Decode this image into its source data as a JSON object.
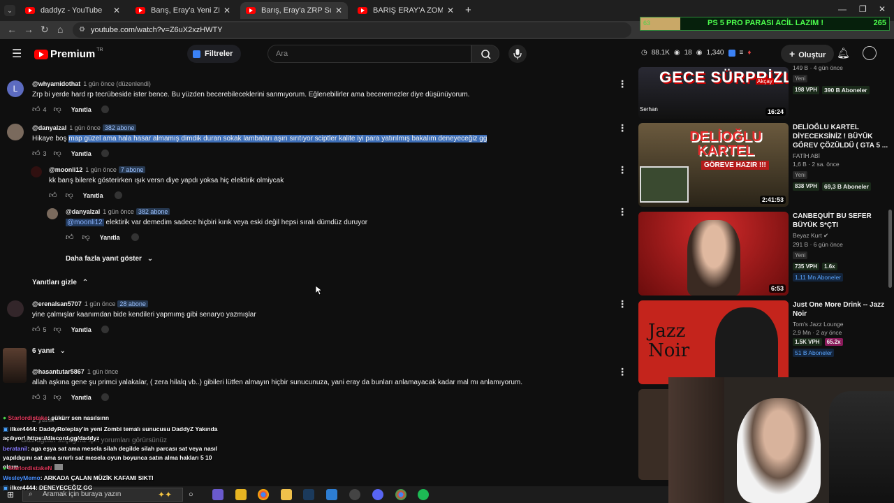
{
  "tabs": [
    {
      "title": "daddyz - YouTube"
    },
    {
      "title": "Barış, Eray'a Yeni ZRP Sunucusu"
    },
    {
      "title": "Barış, Eray'a ZRP Sunucusunun"
    },
    {
      "title": "BARIŞ ERAY'A ZOMBİ RP SUNU"
    }
  ],
  "address": {
    "url": "youtube.com/watch?v=Z6uX2xzHWTY"
  },
  "header": {
    "logo": "Premium",
    "region": "TR",
    "filter_label": "Filtreler",
    "search_placeholder": "Ara",
    "stats": [
      "88.1K",
      "18",
      "1,340"
    ],
    "create_label": "Oluştur"
  },
  "banner": {
    "left": "63",
    "message": "PS 5 PRO PARASI ACİL LAZIM !",
    "count": "265",
    "progress_fraction": 0.16
  },
  "comments": [
    {
      "handle": "@whyamidothat",
      "time": "1 gün önce (düzenlendi)",
      "text": "Zrp bi yerde hard rp tecrübeside ister bence. Bu yüzden becerebileceklerini sanmıyorum. Eğlenebilirler ama beceremezler diye düşünüyorum.",
      "likes": "4",
      "reply_label": "Yanıtla"
    },
    {
      "handle": "@danyalzal",
      "time": "1 gün önce",
      "badge": "382 abone",
      "text_plain": "Hikaye boş ",
      "text_highlight": "map güzel ama hala hasar almamış dimdik duran sokak lambaları aşırı sırıtıyor sciptler kalite iyi para yatırılmış bakalım deneyeceğiz gg",
      "likes": "3",
      "reply_label": "Yanıtla"
    },
    {
      "handle": "@moonli12",
      "time": "1 gün önce",
      "badge": "7 abone",
      "text": "kk barış  bilerek gösterirken ışık versn diye yapdı yoksa hiç elektirik olmiycak",
      "likes": "",
      "reply_label": "Yanıtla"
    },
    {
      "handle": "@danyalzal",
      "time": "1 gün önce",
      "badge": "382 abone",
      "mention": "@moonli12",
      "text": " elektirik var demedim sadece hiçbiri kırık veya eski değil hepsi sıralı dümdüz duruyor",
      "likes": "",
      "reply_label": "Yanıtla"
    },
    {
      "handle": "@erenalsan5707",
      "time": "1 gün önce",
      "badge": "28 abone",
      "text": "yine çalmışlar kaanımdan bide kendileri yapmımş gibi senaryo yazmışlar",
      "likes": "5",
      "reply_label": "Yanıtla"
    },
    {
      "handle": "@hasantutar5867",
      "time": "1 gün önce",
      "text": "allah aşkına gene şu primci yalakalar, ( zera hilalq vb..) gibileri lütfen almayın hiçbir sunucunuza, yani eray da bunları anlamayacak kadar mal mı anlamıyorum.",
      "likes": "3",
      "reply_label": "Yanıtla"
    }
  ],
  "links": {
    "more_replies": "Daha fazla yanıt göster",
    "hide_replies": "Yanıtları gizle",
    "six_replies": "6 yanıt"
  },
  "videos": [
    {
      "title": "",
      "channel": "",
      "meta": "149 B · 4 gün önce",
      "new": "Yeni",
      "vph": "198 VPH",
      "subs": "390 B Aboneler",
      "duration": "16:24",
      "thumb_text": "GECE SÜRPRİZLERİ",
      "thumb_sub": "Serhan",
      "thumb_tag": "Akçay"
    },
    {
      "title": "DELİOĞLU KARTEL DİYECEKSİNİZ ! BÜYÜK GÖREV ÇÖZÜLDÜ ( GTA 5 ...",
      "channel": "FATİH ABİ",
      "meta": "1,6 B · 2 sa. önce",
      "new": "Yeni",
      "vph": "838 VPH",
      "subs": "69,3 B Aboneler",
      "duration": "2:41:53",
      "thumb_text": "DELİOĞLU KARTEL",
      "thumb_sub": "GÖREVE HAZIR !!!"
    },
    {
      "title": "CANBEQUİT BU SEFER BÜYÜK S*ÇTI",
      "channel": "Beyaz Kurt",
      "meta": "291 B · 6 gün önce",
      "new": "Yeni",
      "vph": "735 VPH",
      "ratio": "1.6x",
      "subs": "1,11 Mn Aboneler",
      "duration": "6:53"
    },
    {
      "title": "Just One More Drink -- Jazz Noir",
      "channel": "Tom's Jazz Lounge",
      "meta": "2,9 Mn · 2 ay önce",
      "vph": "1.5K VPH",
      "ratio": "65.2x",
      "subs": "51 B Aboneler",
      "thumb_text": "Jazz Noir"
    }
  ],
  "chat": [
    {
      "user": "Starlordistake",
      "msg": ": şükürr sen nasılsınn",
      "color": "#e0375a"
    },
    {
      "user": "ilker4444",
      "msg": ": DaddyRoleplay'in yeni Zombi temalı sunucusu DaddyZ Yakında açılıyor! https://discord.gg/daddyz",
      "color": "#ffffff"
    },
    {
      "user": "beratanil",
      "msg": ": aga eşya sat ama mesela silah degilde silah parcası sat veya nasıl yapıldıgını sat ama sınırlı sat mesela oyun boyunca satın alma hakları 5 10 olsun",
      "color": "#8a7dff"
    },
    {
      "user": "StarlordistakeN",
      "msg": "",
      "color": "#e0375a"
    },
    {
      "user": "WesleyMemo",
      "msg": ": ARKADA ÇALAN MÜZİK KAFAMI SIKTI",
      "color": "#4a90ff"
    },
    {
      "user": "ilker4444",
      "msg": ": DENEYECEĞİZ GG",
      "color": "#ffffff"
    }
  ],
  "behind_text": {
    "replies": "2 yanıt",
    "hidden": "Gizli öğeler seçtiğiniz için yorumları görürsünüz"
  },
  "taskbar": {
    "search_placeholder": "Aramak için buraya yazın"
  },
  "colors": {
    "accent": "#3e6fb8",
    "red": "#ff0000",
    "banner_green": "#4dff4d"
  }
}
